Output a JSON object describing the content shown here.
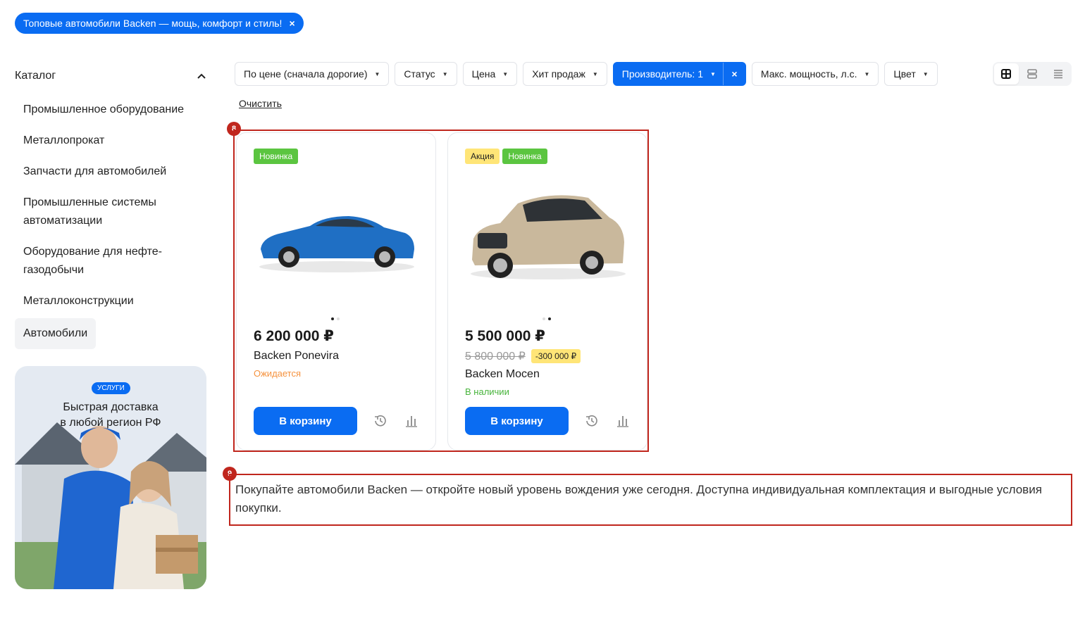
{
  "top_tag": {
    "label": "Топовые автомобили Backen — мощь, комфорт и стиль!",
    "close": "×"
  },
  "sidebar": {
    "heading": "Каталог",
    "items": [
      {
        "label": "Промышленное оборудование"
      },
      {
        "label": "Металлопрокат"
      },
      {
        "label": "Запчасти для автомобилей"
      },
      {
        "label": "Промышленные системы автоматизации"
      },
      {
        "label": "Оборудование для нефте-газодобычи"
      },
      {
        "label": "Металлоконструкции"
      },
      {
        "label": "Автомобили",
        "active": true
      }
    ]
  },
  "banner": {
    "pill": "УСЛУГИ",
    "title_line1": "Быстрая доставка",
    "title_line2": "в любой регион РФ"
  },
  "filters": [
    {
      "label": "По цене (сначала дорогие)"
    },
    {
      "label": "Статус"
    },
    {
      "label": "Цена"
    },
    {
      "label": "Хит продаж"
    },
    {
      "label": "Производитель: 1",
      "active": true
    },
    {
      "label": "Макс. мощность, л.с."
    },
    {
      "label": "Цвет"
    }
  ],
  "filter_close": "×",
  "clear_label": "Очистить",
  "annotations": {
    "cards": "8",
    "description": "9"
  },
  "products": [
    {
      "labels": [
        "Новинка"
      ],
      "price": "6 200 000 ₽",
      "name": "Backen Ponevira",
      "status": "Ожидается",
      "car_color": "#1f6fc4",
      "cart_label": "В корзину"
    },
    {
      "labels": [
        "Акция",
        "Новинка"
      ],
      "price": "5 500 000 ₽",
      "old_price": "5 800 000 ₽",
      "discount": "-300 000 ₽",
      "name": "Backen Mocen",
      "status": "В наличии",
      "car_color": "#c9b89c",
      "cart_label": "В корзину"
    }
  ],
  "description": "Покупайте автомобили Backen — откройте новый уровень вождения уже сегодня. Доступна индивидуальная комплектация и выгодные условия покупки.",
  "colors": {
    "accent": "#0a6cf2",
    "annotation": "#c0261d",
    "new": "#5bc540",
    "sale": "#ffe577"
  }
}
